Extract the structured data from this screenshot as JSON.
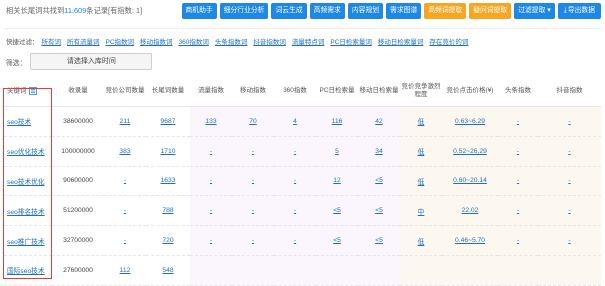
{
  "summary": {
    "prefix": "相关长尾词共找到",
    "count": "11,609",
    "suffix": "条记录[有指数: 1]"
  },
  "toolbar": {
    "buttons": [
      {
        "label": "商机助手"
      },
      {
        "label": "细分行业分析"
      },
      {
        "label": "词云生成"
      },
      {
        "label": "高频需求"
      },
      {
        "label": "内容规划"
      },
      {
        "label": "需求图谱"
      },
      {
        "label": "高频词提取"
      },
      {
        "label": "疑问词提取"
      },
      {
        "label": "过滤提取 ▾"
      }
    ],
    "export_label": "导出数据",
    "export_icon": "download-icon",
    "accent_color": "#1e88e5",
    "highlight_color": "#f5a623"
  },
  "quick_filter": {
    "label": "快捷过滤：",
    "options": [
      "所有词",
      "所有流量词",
      "PC指数词",
      "移动指数词",
      "360指数词",
      "头条指数词",
      "抖音指数词",
      "流量特点词",
      "PC日检索量词",
      "移动日检索量词",
      "存在竞价的词"
    ]
  },
  "filter": {
    "label": "筛选：",
    "date_button": "请选择入库时间"
  },
  "table": {
    "headers": [
      "关键词",
      "收录量",
      "竞价公司数量",
      "长尾词数量",
      "流量指数",
      "移动指数",
      "360指数",
      "PC日检索量",
      "移动日检索量",
      "竞价竞争激烈程度",
      "竞价点击价格(¥)",
      "头条指数",
      "抖音指数"
    ],
    "rows": [
      {
        "keyword": "seo技术",
        "indexed": "38600000",
        "bid_companies": "211",
        "longtail": "9687",
        "traffic": "133",
        "mobile": "70",
        "idx360": "4",
        "pc_daily": "116",
        "mobile_daily": "42",
        "competition": "低",
        "price": "0.63~6.29",
        "toutiao": "-",
        "douyin": "-"
      },
      {
        "keyword": "seo优化技术",
        "indexed": "100000000",
        "bid_companies": "383",
        "longtail": "1710",
        "traffic": "-",
        "mobile": "-",
        "idx360": "-",
        "pc_daily": "5",
        "mobile_daily": "34",
        "competition": "低",
        "price": "0.52~26.29",
        "toutiao": "-",
        "douyin": "-"
      },
      {
        "keyword": "seo技术优化",
        "indexed": "90600000",
        "bid_companies": "-",
        "longtail": "1633",
        "traffic": "-",
        "mobile": "-",
        "idx360": "-",
        "pc_daily": "12",
        "mobile_daily": "<5",
        "competition": "低",
        "price": "0.60~20.14",
        "toutiao": "-",
        "douyin": "-"
      },
      {
        "keyword": "seo排名技术",
        "indexed": "51200000",
        "bid_companies": "-",
        "longtail": "788",
        "traffic": "-",
        "mobile": "-",
        "idx360": "-",
        "pc_daily": "<5",
        "mobile_daily": "<5",
        "competition": "中",
        "price": "22.02",
        "toutiao": "-",
        "douyin": "-"
      },
      {
        "keyword": "seo推广技术",
        "indexed": "32700000",
        "bid_companies": "-",
        "longtail": "720",
        "traffic": "-",
        "mobile": "-",
        "idx360": "-",
        "pc_daily": "<5",
        "mobile_daily": "<5",
        "competition": "低",
        "price": "0.46~5.70",
        "toutiao": "-",
        "douyin": "-"
      },
      {
        "keyword": "国际seo技术",
        "indexed": "27600000",
        "bid_companies": "112",
        "longtail": "548",
        "traffic": "",
        "mobile": "",
        "idx360": "",
        "pc_daily": "",
        "mobile_daily": "",
        "competition": "",
        "price": "",
        "toutiao": "",
        "douyin": ""
      }
    ]
  }
}
